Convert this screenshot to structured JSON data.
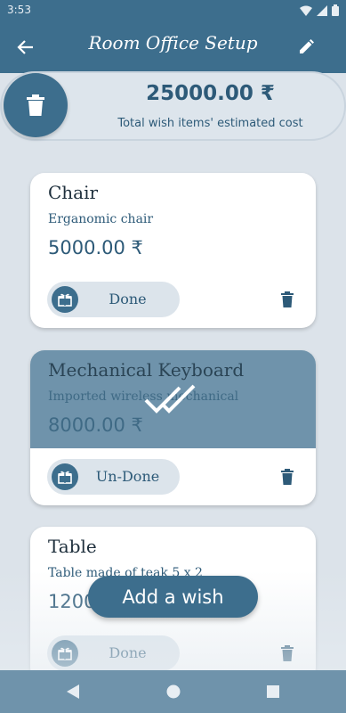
{
  "status_bar": {
    "time": "3:53"
  },
  "app_bar": {
    "title": "Room Office Setup"
  },
  "summary": {
    "total": "25000.00 ₹",
    "label": "Total wish items' estimated cost"
  },
  "items": [
    {
      "name": "Chair",
      "description": "Erganomic chair",
      "price": "5000.00 ₹",
      "toggle_label": "Done",
      "done": false
    },
    {
      "name": "Mechanical Keyboard",
      "description": "Imported wireless mechanical",
      "price": "8000.00 ₹",
      "toggle_label": "Un-Done",
      "done": true
    },
    {
      "name": "Table",
      "description": "Table made of teak 5 x 2",
      "price": "12000.00 ₹",
      "toggle_label": "Done",
      "done": false
    }
  ],
  "fab": {
    "label": "Add a wish"
  },
  "colors": {
    "primary": "#3d6e8d",
    "done_overlay": "#6f93ab",
    "background": "#dce3ea"
  }
}
